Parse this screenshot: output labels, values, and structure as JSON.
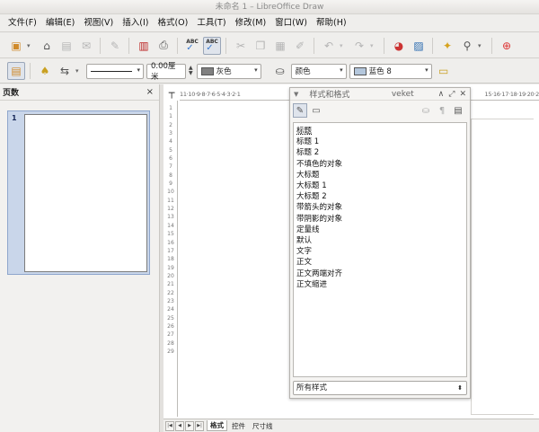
{
  "window": {
    "title": "未命名 1 – LibreOffice Draw"
  },
  "menu": [
    "文件(F)",
    "编辑(E)",
    "视图(V)",
    "插入(I)",
    "格式(O)",
    "工具(T)",
    "修改(M)",
    "窗口(W)",
    "帮助(H)"
  ],
  "line_props": {
    "line_width": "0.00厘米",
    "line_color": "灰色",
    "area_fill": "颜色",
    "area_color": "蓝色 8",
    "colors": {
      "line": "#808080",
      "area": "#b4c7dc"
    }
  },
  "pages_panel": {
    "title": "页数",
    "close": "×",
    "pages": [
      {
        "number": "1"
      }
    ]
  },
  "ruler": {
    "top_left": "11·10·9·8·7·6·5·4·3·2·1",
    "top_right": "15·16·17·18·19·20·2",
    "left_ticks": [
      "1",
      "1",
      "2",
      "3",
      "4",
      "5",
      "6",
      "7",
      "8",
      "9",
      "10",
      "11",
      "12",
      "13",
      "14",
      "15",
      "16",
      "17",
      "18",
      "19",
      "20",
      "21",
      "22",
      "23",
      "24",
      "25",
      "26",
      "27",
      "28",
      "29"
    ]
  },
  "sheet_tabs": [
    "格式",
    "控件",
    "尺寸线"
  ],
  "styles_panel": {
    "title": "样式和格式",
    "extra_label": "veket",
    "items": [
      "标题",
      "标题 1",
      "标题 2",
      "不填色的对象",
      "大标题",
      "大标题 1",
      "大标题 2",
      "带箭头的对象",
      "带阴影的对象",
      "定量线",
      "默认",
      "文字",
      "正文",
      "正文两端对齐",
      "正文缩进"
    ],
    "filter": "所有样式"
  }
}
